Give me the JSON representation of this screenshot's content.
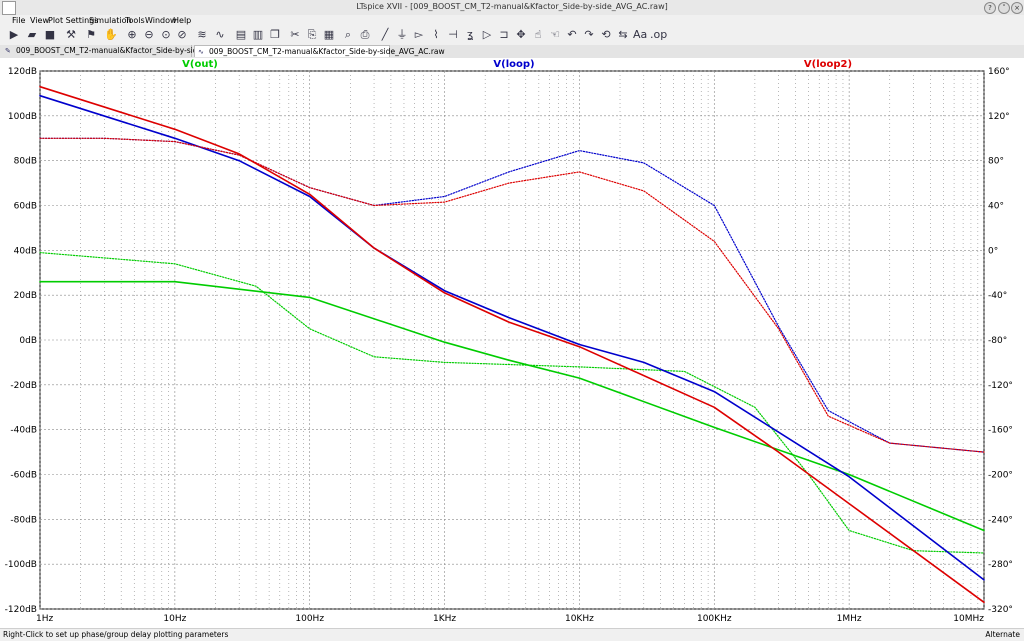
{
  "window": {
    "title": "LTspice XVII - [009_BOOST_CM_T2-manual&Kfactor_Side-by-side_AVG_AC.raw]"
  },
  "menu": [
    "File",
    "View",
    "Plot Settings",
    "Simulation",
    "Tools",
    "Window",
    "Help"
  ],
  "toolbar": {
    "icons": [
      "run-icon",
      "open-icon",
      "save-icon",
      "control-panel-icon",
      "run-man-icon",
      "zoom-in-icon",
      "zoom-out-icon",
      "zoom-fit-icon",
      "zoom-cancel-icon",
      "autorange-icon",
      "tile-vertical-icon",
      "tile-horizontal-icon",
      "cascade-icon",
      "window-icon",
      "cut-icon",
      "copy-icon",
      "paste-icon",
      "find-icon",
      "print-icon",
      "wire-icon",
      "ground-icon",
      "label-icon",
      "resistor-icon",
      "capacitor-icon",
      "inductor-icon",
      "diode-icon",
      "component-icon",
      "move-icon",
      "drag-icon",
      "undo-icon",
      "redo-icon",
      "rotate-icon",
      "mirror-icon",
      "text-icon",
      "spice-directive-icon"
    ]
  },
  "tabs": [
    {
      "label": "009_BOOST_CM_T2-manual&Kfactor_Side-by-side_AVG_AC.asc",
      "active": false
    },
    {
      "label": "009_BOOST_CM_T2-manual&Kfactor_Side-by-side_AVG_AC.raw",
      "active": true
    }
  ],
  "plot": {
    "traces": [
      {
        "name": "V(out)",
        "color": "#00cc00"
      },
      {
        "name": "V(loop)",
        "color": "#0000cc"
      },
      {
        "name": "V(loop2)",
        "color": "#dd0000"
      }
    ],
    "xTicks": [
      "1Hz",
      "10Hz",
      "100Hz",
      "1KHz",
      "10KHz",
      "100KHz",
      "1MHz",
      "10MHz"
    ],
    "yLeftTicks": [
      "120dB",
      "100dB",
      "80dB",
      "60dB",
      "40dB",
      "20dB",
      "0dB",
      "-20dB",
      "-40dB",
      "-60dB",
      "-80dB",
      "-100dB",
      "-120dB"
    ],
    "yRightTicks": [
      "160°",
      "120°",
      "80°",
      "40°",
      "0°",
      "-40°",
      "-80°",
      "-120°",
      "-160°",
      "-200°",
      "-240°",
      "-280°",
      "-320°"
    ],
    "grid": "dotted"
  },
  "chart_data": {
    "type": "line",
    "title": "",
    "xlabel": "",
    "ylabel": "",
    "xscale": "log",
    "xlim": [
      1,
      10000000
    ],
    "ylim": [
      -120,
      120
    ],
    "ylim_right": [
      -320,
      160
    ],
    "series": [
      {
        "name": "V(out)",
        "kind": "magnitude",
        "color": "#00cc00",
        "x": [
          1,
          10,
          100,
          1000,
          3000,
          10000,
          100000,
          1000000,
          10000000
        ],
        "y": [
          26,
          26,
          19,
          -1,
          -9,
          -17,
          -39,
          -60,
          -85
        ]
      },
      {
        "name": "V(out)",
        "kind": "phase",
        "color": "#00cc00",
        "x": [
          1,
          10,
          40,
          100,
          300,
          1000,
          10000,
          60000,
          200000,
          500000,
          1000000,
          3000000,
          10000000
        ],
        "y": [
          -2,
          -12,
          -32,
          -70,
          -95,
          -100,
          -104,
          -108,
          -140,
          -200,
          -250,
          -268,
          -270
        ]
      },
      {
        "name": "V(loop)",
        "kind": "magnitude",
        "color": "#0000cc",
        "x": [
          1,
          10,
          30,
          100,
          300,
          1000,
          3000,
          10000,
          30000,
          100000,
          1000000,
          10000000
        ],
        "y": [
          109,
          90,
          80,
          64,
          41,
          22,
          10,
          -2,
          -10,
          -23,
          -61,
          -107
        ]
      },
      {
        "name": "V(loop)",
        "kind": "phase",
        "color": "#0000cc",
        "x": [
          1,
          3,
          10,
          30,
          100,
          300,
          1000,
          3000,
          10000,
          30000,
          100000,
          300000,
          700000,
          2000000,
          10000000
        ],
        "y": [
          100,
          100,
          97,
          85,
          56,
          40,
          48,
          70,
          89,
          78,
          40,
          -68,
          -143,
          -172,
          -180
        ]
      },
      {
        "name": "V(loop2)",
        "kind": "magnitude",
        "color": "#dd0000",
        "x": [
          1,
          10,
          30,
          100,
          300,
          1000,
          3000,
          10000,
          100000,
          300000,
          1000000,
          10000000
        ],
        "y": [
          113,
          94,
          83,
          65,
          41,
          21,
          8,
          -3,
          -30,
          -50,
          -73,
          -117
        ]
      },
      {
        "name": "V(loop2)",
        "kind": "phase",
        "color": "#dd0000",
        "x": [
          1,
          3,
          10,
          30,
          100,
          300,
          1000,
          3000,
          10000,
          30000,
          100000,
          300000,
          700000,
          2000000,
          10000000
        ],
        "y": [
          100,
          100,
          97,
          85,
          56,
          40,
          43,
          60,
          70,
          53,
          8,
          -70,
          -148,
          -172,
          -180
        ]
      }
    ]
  },
  "status": {
    "left": "Right-Click to set up phase/group delay plotting parameters",
    "right": "Alternate"
  }
}
